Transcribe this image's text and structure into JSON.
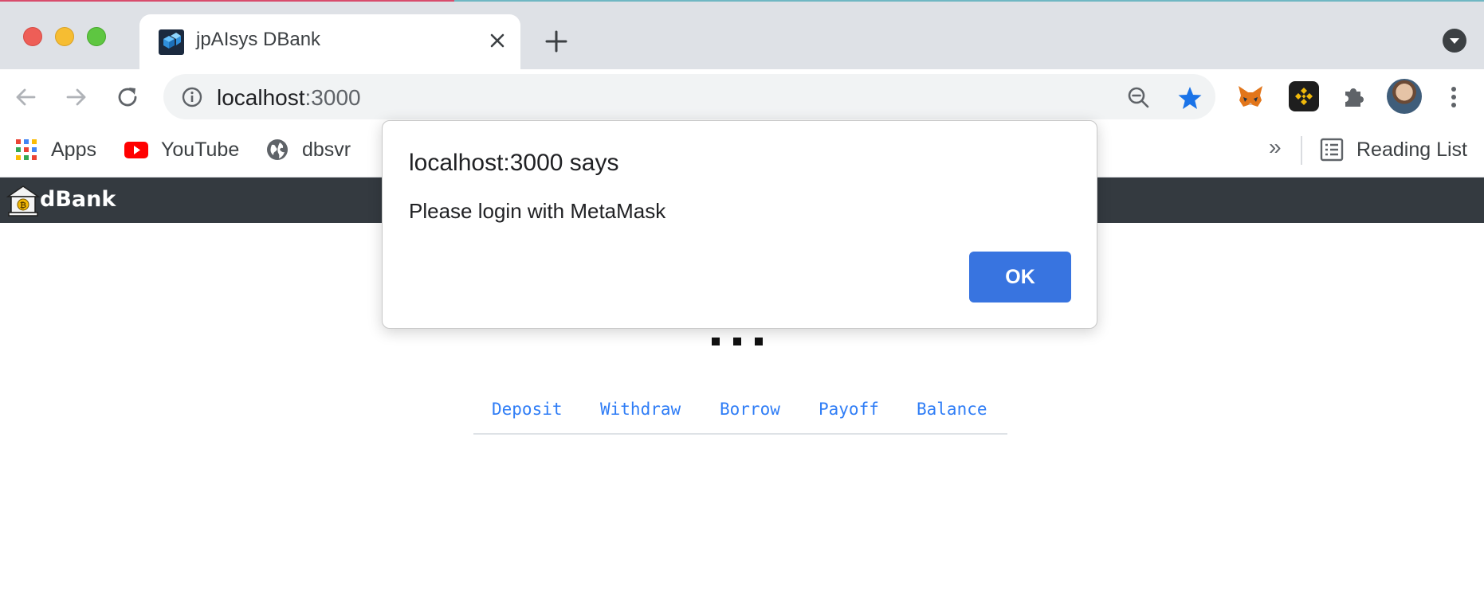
{
  "window": {
    "controls": [
      "close",
      "minimize",
      "maximize"
    ]
  },
  "tab": {
    "title": "jpAIsys DBank",
    "favicon": "cube-logo-icon"
  },
  "toolbar": {
    "url_host": "localhost",
    "url_port": ":3000",
    "extensions": [
      "metamask-fox-icon",
      "binance-icon",
      "puzzle-extensions-icon"
    ]
  },
  "bookmarks": {
    "items": [
      {
        "label": "Apps",
        "icon": "apps-grid-icon"
      },
      {
        "label": "YouTube",
        "icon": "youtube-icon"
      },
      {
        "label": "dbsvr",
        "icon": "globe-icon"
      }
    ],
    "overflow": "»",
    "reading_list": "Reading List"
  },
  "page": {
    "brand": "dBank",
    "tabs": [
      "Deposit",
      "Withdraw",
      "Borrow",
      "Payoff",
      "Balance"
    ],
    "accent_color": "#2f7df6",
    "navbar_color": "#343a40"
  },
  "dialog": {
    "title": "localhost:3000 says",
    "message": "Please login with MetaMask",
    "ok_label": "OK",
    "button_color": "#3874e0"
  }
}
